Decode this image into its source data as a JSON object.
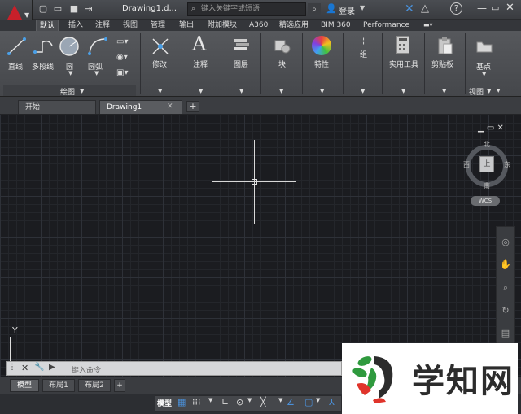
{
  "titlebar": {
    "document_title": "Drawing1.d...",
    "search_placeholder": "键入关键字或短语",
    "login_label": "登录"
  },
  "ribbon_tabs": [
    "默认",
    "插入",
    "注释",
    "视图",
    "管理",
    "输出",
    "附加模块",
    "A360",
    "精选应用",
    "BIM 360",
    "Performance"
  ],
  "ribbon_panels": {
    "draw": {
      "tools": [
        "直线",
        "多段线",
        "圆",
        "圆弧"
      ],
      "footer": "绘图"
    },
    "modify": "修改",
    "annotate": "注释",
    "layers": "图层",
    "block": "块",
    "properties": "特性",
    "groups": "组",
    "utilities": "实用工具",
    "clipboard": "剪贴板",
    "base": "基点",
    "view": "视图"
  },
  "doc_tabs": {
    "start": "开始",
    "drawing": "Drawing1"
  },
  "viewcube": {
    "north": "北",
    "south": "南",
    "east": "东",
    "west": "西",
    "face": "上",
    "wcs": "WCS"
  },
  "ucs": {
    "y_label": "Y"
  },
  "command": {
    "placeholder": "键入命令"
  },
  "layout_tabs": [
    "模型",
    "布局1",
    "布局2"
  ],
  "statusbar": {
    "model_label": "模型"
  },
  "watermark": {
    "text": "学知网"
  }
}
